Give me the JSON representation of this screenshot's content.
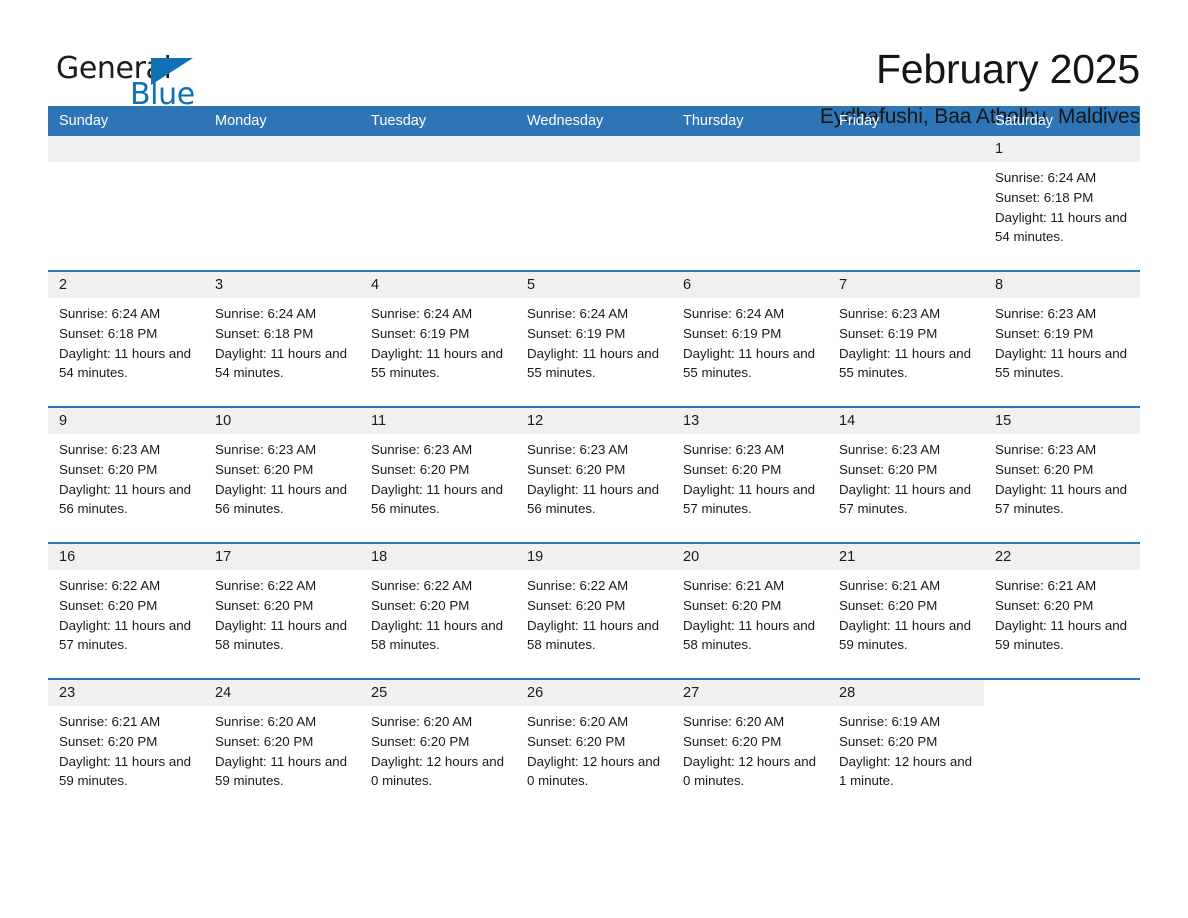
{
  "brand": {
    "name_part1": "General",
    "name_part2": "Blue",
    "accent_color": "#1271b5"
  },
  "header": {
    "title": "February 2025",
    "subtitle": "Eydhafushi, Baa Atholhu, Maldives"
  },
  "calendar": {
    "header_color": "#2e75b6",
    "day_band_color": "#f0f0f0",
    "weekdays": [
      "Sunday",
      "Monday",
      "Tuesday",
      "Wednesday",
      "Thursday",
      "Friday",
      "Saturday"
    ],
    "weeks": [
      [
        {
          "day": "",
          "empty": true
        },
        {
          "day": "",
          "empty": true
        },
        {
          "day": "",
          "empty": true
        },
        {
          "day": "",
          "empty": true
        },
        {
          "day": "",
          "empty": true
        },
        {
          "day": "",
          "empty": true
        },
        {
          "day": "1",
          "sunrise": "Sunrise: 6:24 AM",
          "sunset": "Sunset: 6:18 PM",
          "daylight": "Daylight: 11 hours and 54 minutes."
        }
      ],
      [
        {
          "day": "2",
          "sunrise": "Sunrise: 6:24 AM",
          "sunset": "Sunset: 6:18 PM",
          "daylight": "Daylight: 11 hours and 54 minutes."
        },
        {
          "day": "3",
          "sunrise": "Sunrise: 6:24 AM",
          "sunset": "Sunset: 6:18 PM",
          "daylight": "Daylight: 11 hours and 54 minutes."
        },
        {
          "day": "4",
          "sunrise": "Sunrise: 6:24 AM",
          "sunset": "Sunset: 6:19 PM",
          "daylight": "Daylight: 11 hours and 55 minutes."
        },
        {
          "day": "5",
          "sunrise": "Sunrise: 6:24 AM",
          "sunset": "Sunset: 6:19 PM",
          "daylight": "Daylight: 11 hours and 55 minutes."
        },
        {
          "day": "6",
          "sunrise": "Sunrise: 6:24 AM",
          "sunset": "Sunset: 6:19 PM",
          "daylight": "Daylight: 11 hours and 55 minutes."
        },
        {
          "day": "7",
          "sunrise": "Sunrise: 6:23 AM",
          "sunset": "Sunset: 6:19 PM",
          "daylight": "Daylight: 11 hours and 55 minutes."
        },
        {
          "day": "8",
          "sunrise": "Sunrise: 6:23 AM",
          "sunset": "Sunset: 6:19 PM",
          "daylight": "Daylight: 11 hours and 55 minutes."
        }
      ],
      [
        {
          "day": "9",
          "sunrise": "Sunrise: 6:23 AM",
          "sunset": "Sunset: 6:20 PM",
          "daylight": "Daylight: 11 hours and 56 minutes."
        },
        {
          "day": "10",
          "sunrise": "Sunrise: 6:23 AM",
          "sunset": "Sunset: 6:20 PM",
          "daylight": "Daylight: 11 hours and 56 minutes."
        },
        {
          "day": "11",
          "sunrise": "Sunrise: 6:23 AM",
          "sunset": "Sunset: 6:20 PM",
          "daylight": "Daylight: 11 hours and 56 minutes."
        },
        {
          "day": "12",
          "sunrise": "Sunrise: 6:23 AM",
          "sunset": "Sunset: 6:20 PM",
          "daylight": "Daylight: 11 hours and 56 minutes."
        },
        {
          "day": "13",
          "sunrise": "Sunrise: 6:23 AM",
          "sunset": "Sunset: 6:20 PM",
          "daylight": "Daylight: 11 hours and 57 minutes."
        },
        {
          "day": "14",
          "sunrise": "Sunrise: 6:23 AM",
          "sunset": "Sunset: 6:20 PM",
          "daylight": "Daylight: 11 hours and 57 minutes."
        },
        {
          "day": "15",
          "sunrise": "Sunrise: 6:23 AM",
          "sunset": "Sunset: 6:20 PM",
          "daylight": "Daylight: 11 hours and 57 minutes."
        }
      ],
      [
        {
          "day": "16",
          "sunrise": "Sunrise: 6:22 AM",
          "sunset": "Sunset: 6:20 PM",
          "daylight": "Daylight: 11 hours and 57 minutes."
        },
        {
          "day": "17",
          "sunrise": "Sunrise: 6:22 AM",
          "sunset": "Sunset: 6:20 PM",
          "daylight": "Daylight: 11 hours and 58 minutes."
        },
        {
          "day": "18",
          "sunrise": "Sunrise: 6:22 AM",
          "sunset": "Sunset: 6:20 PM",
          "daylight": "Daylight: 11 hours and 58 minutes."
        },
        {
          "day": "19",
          "sunrise": "Sunrise: 6:22 AM",
          "sunset": "Sunset: 6:20 PM",
          "daylight": "Daylight: 11 hours and 58 minutes."
        },
        {
          "day": "20",
          "sunrise": "Sunrise: 6:21 AM",
          "sunset": "Sunset: 6:20 PM",
          "daylight": "Daylight: 11 hours and 58 minutes."
        },
        {
          "day": "21",
          "sunrise": "Sunrise: 6:21 AM",
          "sunset": "Sunset: 6:20 PM",
          "daylight": "Daylight: 11 hours and 59 minutes."
        },
        {
          "day": "22",
          "sunrise": "Sunrise: 6:21 AM",
          "sunset": "Sunset: 6:20 PM",
          "daylight": "Daylight: 11 hours and 59 minutes."
        }
      ],
      [
        {
          "day": "23",
          "sunrise": "Sunrise: 6:21 AM",
          "sunset": "Sunset: 6:20 PM",
          "daylight": "Daylight: 11 hours and 59 minutes."
        },
        {
          "day": "24",
          "sunrise": "Sunrise: 6:20 AM",
          "sunset": "Sunset: 6:20 PM",
          "daylight": "Daylight: 11 hours and 59 minutes."
        },
        {
          "day": "25",
          "sunrise": "Sunrise: 6:20 AM",
          "sunset": "Sunset: 6:20 PM",
          "daylight": "Daylight: 12 hours and 0 minutes."
        },
        {
          "day": "26",
          "sunrise": "Sunrise: 6:20 AM",
          "sunset": "Sunset: 6:20 PM",
          "daylight": "Daylight: 12 hours and 0 minutes."
        },
        {
          "day": "27",
          "sunrise": "Sunrise: 6:20 AM",
          "sunset": "Sunset: 6:20 PM",
          "daylight": "Daylight: 12 hours and 0 minutes."
        },
        {
          "day": "28",
          "sunrise": "Sunrise: 6:19 AM",
          "sunset": "Sunset: 6:20 PM",
          "daylight": "Daylight: 12 hours and 1 minute."
        },
        {
          "day": "",
          "empty": true,
          "blank": true
        }
      ]
    ]
  }
}
